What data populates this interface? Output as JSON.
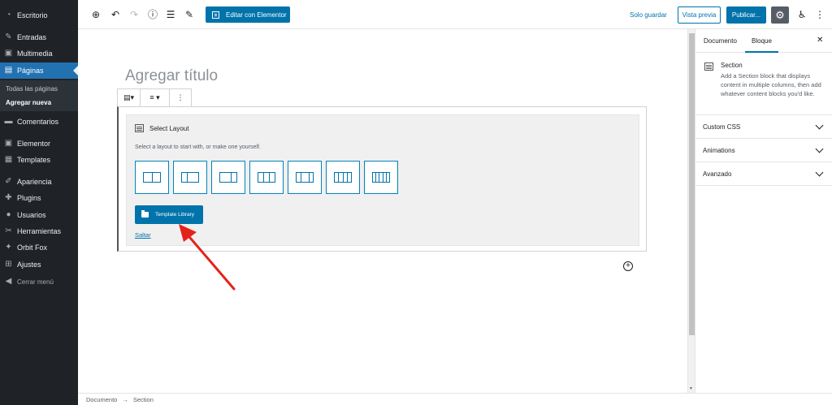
{
  "admin_menu": {
    "items": [
      {
        "id": "escritorio",
        "label": "Escritorio",
        "icon": "dashboard-icon",
        "glyph": "◔"
      },
      {
        "id": "entradas",
        "label": "Entradas",
        "icon": "pin-icon",
        "glyph": "✎"
      },
      {
        "id": "multimedia",
        "label": "Multimedia",
        "icon": "media-icon",
        "glyph": "▣"
      },
      {
        "id": "paginas",
        "label": "Páginas",
        "icon": "pages-icon",
        "glyph": "▤",
        "active": true
      },
      {
        "id": "comentarios",
        "label": "Comentarios",
        "icon": "comments-icon",
        "glyph": "▬"
      },
      {
        "id": "elementor",
        "label": "Elementor",
        "icon": "elementor-icon",
        "glyph": "▣"
      },
      {
        "id": "templates",
        "label": "Templates",
        "icon": "templates-icon",
        "glyph": "▦"
      },
      {
        "id": "apariencia",
        "label": "Apariencia",
        "icon": "appearance-icon",
        "glyph": "✐"
      },
      {
        "id": "plugins",
        "label": "Plugins",
        "icon": "plugins-icon",
        "glyph": "✚"
      },
      {
        "id": "usuarios",
        "label": "Usuarios",
        "icon": "users-icon",
        "glyph": "●"
      },
      {
        "id": "herramientas",
        "label": "Herramientas",
        "icon": "tools-icon",
        "glyph": "✂"
      },
      {
        "id": "orbitfox",
        "label": "Orbit Fox",
        "icon": "orbit-fox-icon",
        "glyph": "✦"
      },
      {
        "id": "ajustes",
        "label": "Ajustes",
        "icon": "settings-icon",
        "glyph": "⊞"
      }
    ],
    "submenu": {
      "all_pages": "Todas las páginas",
      "add_new": "Agregar nueva"
    },
    "collapse_label": "Cerrar menú"
  },
  "toolbar": {
    "edit_with_elementor": "Editar con Elementor",
    "save_draft": "Solo guardar",
    "preview": "Vista previa",
    "publish": "Publicar..."
  },
  "editor": {
    "title_placeholder": "Agregar título",
    "section_block": {
      "title": "Select Layout",
      "description": "Select a layout to start with, or make one yourself.",
      "layouts": [
        {
          "name": "layout-2-equal",
          "cols": [
            1,
            1
          ]
        },
        {
          "name": "layout-2-wide-left",
          "cols": [
            1,
            2
          ]
        },
        {
          "name": "layout-2-wide-right",
          "cols": [
            2,
            1
          ]
        },
        {
          "name": "layout-3-equal",
          "cols": [
            1,
            1,
            1
          ]
        },
        {
          "name": "layout-3-wide-center",
          "cols": [
            1,
            2,
            1
          ]
        },
        {
          "name": "layout-4-equal",
          "cols": [
            1,
            1,
            1,
            1
          ]
        },
        {
          "name": "layout-5-equal",
          "cols": [
            1,
            1,
            1,
            1,
            1
          ]
        }
      ],
      "template_library": "Template Library",
      "skip": "Saltar"
    }
  },
  "settings_sidebar": {
    "tabs": {
      "document": "Documento",
      "block": "Bloque"
    },
    "block_card": {
      "title": "Section",
      "description": "Add a Section block that displays content in multiple columns, then add whatever content blocks you'd like."
    },
    "panels": [
      {
        "title": "Custom CSS"
      },
      {
        "title": "Animations"
      },
      {
        "title": "Avanzado"
      }
    ]
  },
  "breadcrumb": {
    "root": "Documento",
    "separator": "→",
    "current": "Section"
  },
  "colors": {
    "accent": "#0073aa",
    "admin_bg": "#1f2328",
    "active_menu": "#2271b1",
    "annotation_arrow": "#e3231b"
  }
}
